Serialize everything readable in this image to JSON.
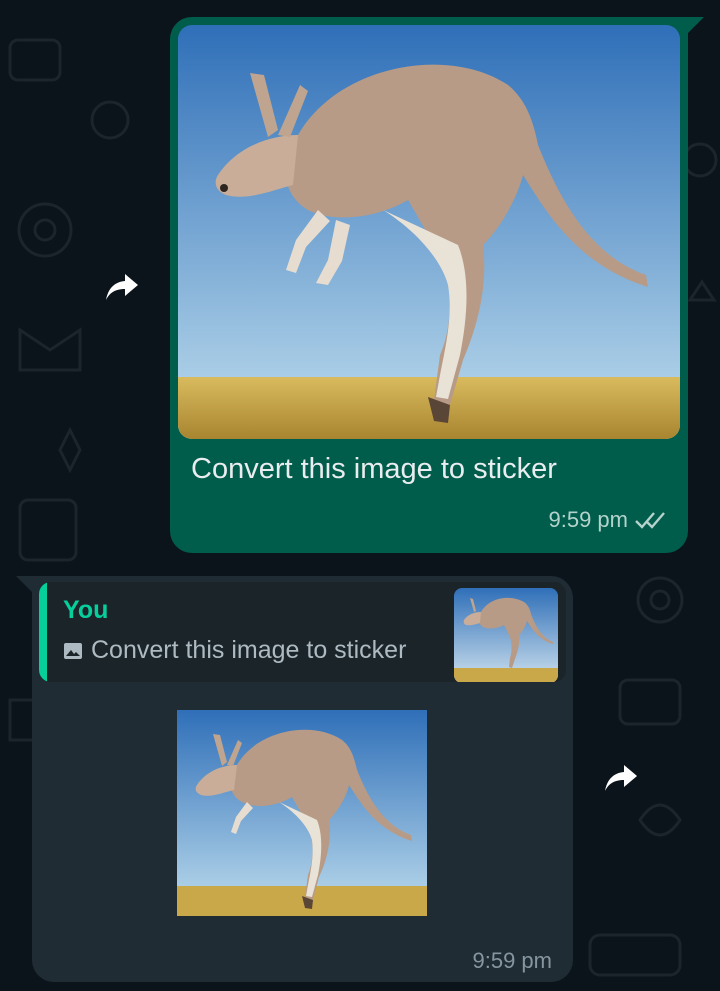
{
  "colors": {
    "background": "#0b141a",
    "outgoing_bubble": "#005c4b",
    "incoming_bubble": "#1f2c33",
    "accent": "#06cf9c",
    "sky_top": "#2f6fb8",
    "grass": "#c9a84a"
  },
  "outgoing_message": {
    "image_subject": "kangaroo-photo",
    "caption": "Convert this image to sticker",
    "time": "9:59 pm",
    "status_icon": "double-check-icon"
  },
  "incoming_message": {
    "reply": {
      "author": "You",
      "icon": "image-icon",
      "text": "Convert this image to sticker"
    },
    "sticker_subject": "kangaroo-sticker",
    "time": "9:59 pm"
  },
  "forward_icons": [
    "forward-icon",
    "forward-icon"
  ]
}
